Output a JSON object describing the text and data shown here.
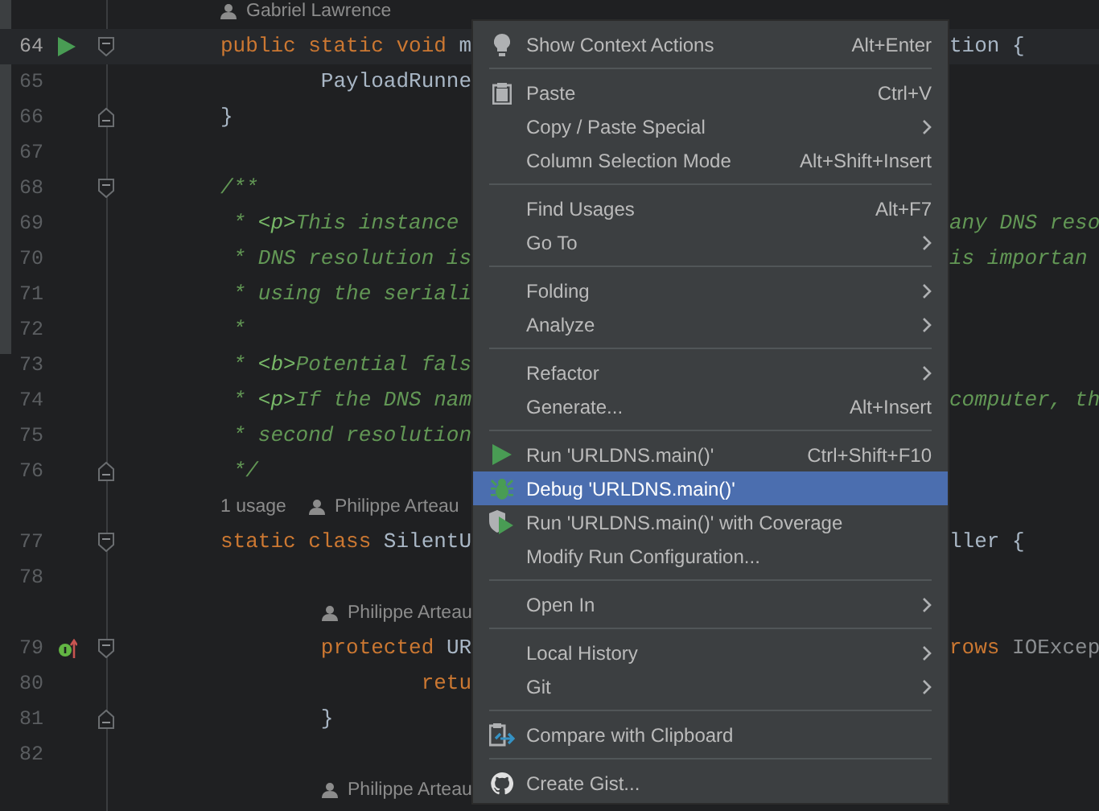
{
  "editor": {
    "lines": [
      {
        "kind": "annotation",
        "author": "Gabriel Lawrence",
        "indented": false
      },
      {
        "kind": "run_fold_start",
        "number": "64",
        "current": true,
        "left": [
          {
            "text": "public static void ",
            "kind": "keyword"
          },
          {
            "text": "m",
            "kind": "plain"
          }
        ],
        "right": [
          {
            "text": "tion {",
            "kind": "plain"
          }
        ]
      },
      {
        "kind": "line",
        "number": "65",
        "current": false,
        "left": [
          {
            "text": "        PayloadRunne",
            "kind": "plain"
          }
        ]
      },
      {
        "kind": "fold_end",
        "number": "66",
        "current": false,
        "left": [
          {
            "text": "}",
            "kind": "plain"
          }
        ]
      },
      {
        "kind": "line",
        "number": "67",
        "current": false
      },
      {
        "kind": "fold_start",
        "number": "68",
        "current": false,
        "left": [
          {
            "text": "/**",
            "kind": "comment"
          }
        ]
      },
      {
        "kind": "line",
        "number": "69",
        "current": false,
        "left": [
          {
            "text": " * ",
            "kind": "comment"
          },
          {
            "text": "<p>",
            "kind": "doc_tag"
          },
          {
            "text": "This instance ",
            "kind": "comment"
          }
        ],
        "right": [
          {
            "text": "any DNS reso",
            "kind": "comment"
          }
        ]
      },
      {
        "kind": "line",
        "number": "70",
        "current": false,
        "left": [
          {
            "text": " * DNS resolution is",
            "kind": "comment"
          }
        ],
        "right": [
          {
            "text": "is importan",
            "kind": "comment"
          }
        ]
      },
      {
        "kind": "line",
        "number": "71",
        "current": false,
        "left": [
          {
            "text": " * using the seriali",
            "kind": "comment"
          }
        ]
      },
      {
        "kind": "line",
        "number": "72",
        "current": false,
        "left": [
          {
            "text": " *",
            "kind": "comment"
          }
        ]
      },
      {
        "kind": "line",
        "number": "73",
        "current": false,
        "left": [
          {
            "text": " * ",
            "kind": "comment"
          },
          {
            "text": "<b>",
            "kind": "doc_tag"
          },
          {
            "text": "Potential fals",
            "kind": "comment"
          }
        ]
      },
      {
        "kind": "line",
        "number": "74",
        "current": false,
        "left": [
          {
            "text": " * ",
            "kind": "comment"
          },
          {
            "text": "<p>",
            "kind": "doc_tag"
          },
          {
            "text": "If the DNS nam",
            "kind": "comment"
          }
        ],
        "right": [
          {
            "text": "computer, th",
            "kind": "comment"
          }
        ]
      },
      {
        "kind": "line",
        "number": "75",
        "current": false,
        "left": [
          {
            "text": " * second resolution",
            "kind": "comment"
          }
        ]
      },
      {
        "kind": "fold_end",
        "number": "76",
        "current": false,
        "left": [
          {
            "text": " */",
            "kind": "comment"
          }
        ]
      },
      {
        "kind": "annotation",
        "usages": "1 usage",
        "author": "Philippe Arteau",
        "indented": false
      },
      {
        "kind": "fold_start",
        "number": "77",
        "current": false,
        "left": [
          {
            "text": "static class ",
            "kind": "keyword"
          },
          {
            "text": "SilentU",
            "kind": "plain"
          }
        ],
        "right": [
          {
            "text": "ller {",
            "kind": "plain"
          }
        ]
      },
      {
        "kind": "line",
        "number": "78",
        "current": false
      },
      {
        "kind": "annotation",
        "author": "Philippe Arteau",
        "indented": true
      },
      {
        "kind": "marker_fold_start",
        "number": "79",
        "current": false,
        "left": [
          {
            "text": "        protected ",
            "kind": "keyword"
          },
          {
            "text": "UR",
            "kind": "plain"
          }
        ],
        "right": [
          {
            "text": "rows ",
            "kind": "keyword"
          },
          {
            "text": "IOExcep",
            "kind": "dim"
          }
        ]
      },
      {
        "kind": "line",
        "number": "80",
        "current": false,
        "left": [
          {
            "text": "                retu",
            "kind": "keyword"
          }
        ]
      },
      {
        "kind": "fold_end",
        "number": "81",
        "current": false,
        "left": [
          {
            "text": "        }",
            "kind": "plain"
          }
        ]
      },
      {
        "kind": "line",
        "number": "82",
        "current": false
      },
      {
        "kind": "annotation",
        "author": "Philippe Arteau",
        "indented": true
      }
    ]
  },
  "context_menu": {
    "items": [
      {
        "kind": "bulb",
        "label": "Show Context Actions",
        "shortcut": "Alt+Enter",
        "submenu": false,
        "selected": false
      },
      {
        "kind": "separator"
      },
      {
        "kind": "clipboard",
        "label": "Paste",
        "shortcut": "Ctrl+V",
        "submenu": false,
        "selected": false
      },
      {
        "kind": "plain",
        "label": "Copy / Paste Special",
        "submenu": true,
        "selected": false
      },
      {
        "kind": "plain",
        "label": "Column Selection Mode",
        "shortcut": "Alt+Shift+Insert",
        "submenu": false,
        "selected": false
      },
      {
        "kind": "separator"
      },
      {
        "kind": "plain",
        "label": "Find Usages",
        "shortcut": "Alt+F7",
        "submenu": false,
        "selected": false
      },
      {
        "kind": "plain",
        "label": "Go To",
        "submenu": true,
        "selected": false
      },
      {
        "kind": "separator"
      },
      {
        "kind": "plain",
        "label": "Folding",
        "submenu": true,
        "selected": false
      },
      {
        "kind": "plain",
        "label": "Analyze",
        "submenu": true,
        "selected": false
      },
      {
        "kind": "separator"
      },
      {
        "kind": "plain",
        "label": "Refactor",
        "submenu": true,
        "selected": false
      },
      {
        "kind": "plain",
        "label": "Generate...",
        "shortcut": "Alt+Insert",
        "submenu": false,
        "selected": false
      },
      {
        "kind": "separator"
      },
      {
        "kind": "run",
        "label": "Run 'URLDNS.main()'",
        "shortcut": "Ctrl+Shift+F10",
        "submenu": false,
        "selected": false
      },
      {
        "kind": "bug",
        "label": "Debug 'URLDNS.main()'",
        "submenu": false,
        "selected": true
      },
      {
        "kind": "coverage",
        "label": "Run 'URLDNS.main()' with Coverage",
        "submenu": false,
        "selected": false
      },
      {
        "kind": "plain",
        "label": "Modify Run Configuration...",
        "submenu": false,
        "selected": false
      },
      {
        "kind": "separator"
      },
      {
        "kind": "plain",
        "label": "Open In",
        "submenu": true,
        "selected": false
      },
      {
        "kind": "separator"
      },
      {
        "kind": "plain",
        "label": "Local History",
        "submenu": true,
        "selected": false
      },
      {
        "kind": "plain",
        "label": "Git",
        "submenu": true,
        "selected": false
      },
      {
        "kind": "separator"
      },
      {
        "kind": "compare",
        "label": "Compare with Clipboard",
        "submenu": false,
        "selected": false
      },
      {
        "kind": "separator"
      },
      {
        "kind": "github",
        "label": "Create Gist...",
        "submenu": false,
        "selected": false
      }
    ]
  }
}
